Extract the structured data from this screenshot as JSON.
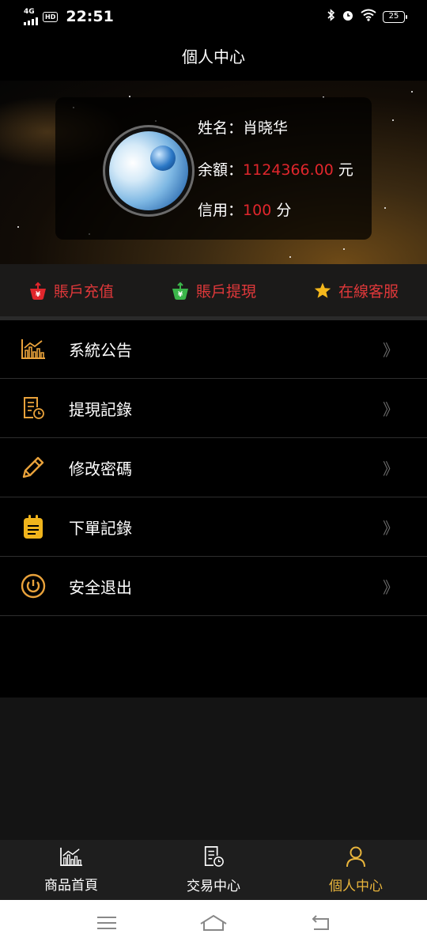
{
  "status_bar": {
    "network": "4G",
    "hd": "HD",
    "time": "22:51",
    "battery": "25"
  },
  "header": {
    "title": "個人中心"
  },
  "profile": {
    "name_label": "姓名：",
    "name": "肖晓华",
    "balance_label": "余額：",
    "balance": "1124366.00",
    "balance_unit": "元",
    "credit_label": "信用：",
    "credit": "100",
    "credit_unit": "分"
  },
  "actions": [
    {
      "label": "賬戶充值",
      "icon": "recharge-basket-icon",
      "color": "#e0262c"
    },
    {
      "label": "賬戶提現",
      "icon": "withdraw-basket-icon",
      "color": "#3bb54a"
    },
    {
      "label": "在線客服",
      "icon": "star-icon",
      "color": "#f5b81c"
    }
  ],
  "menu": [
    {
      "label": "系統公告",
      "icon": "chart-icon",
      "chevron": "》"
    },
    {
      "label": "提現記錄",
      "icon": "record-icon",
      "chevron": "》"
    },
    {
      "label": "修改密碼",
      "icon": "pencil-icon",
      "chevron": "》"
    },
    {
      "label": "下單記錄",
      "icon": "clipboard-icon",
      "chevron": "》"
    },
    {
      "label": "安全退出",
      "icon": "power-icon",
      "chevron": "》"
    }
  ],
  "tabbar": [
    {
      "label": "商品首頁",
      "icon": "chart-icon",
      "active": false
    },
    {
      "label": "交易中心",
      "icon": "record-icon",
      "active": false
    },
    {
      "label": "個人中心",
      "icon": "user-icon",
      "active": true
    }
  ],
  "colors": {
    "accent": "#e9b53c",
    "red": "#e0262c",
    "icon_gold": "#e9a23b"
  }
}
